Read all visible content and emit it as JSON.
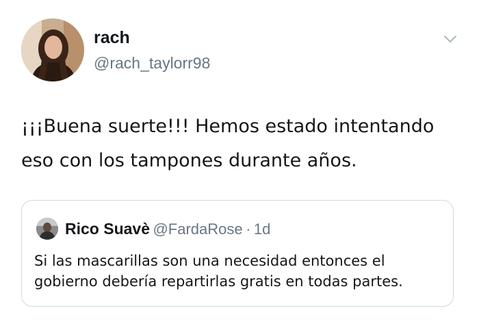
{
  "author": {
    "name": "rach",
    "handle": "@rach_taylorr98"
  },
  "tweet": {
    "text": "¡¡¡Buena suerte!!! Hemos estado intentando\neso con los tampones durante años."
  },
  "quoted": {
    "name": "Rico Suavè",
    "handle": "@FardaRose",
    "separator": "·",
    "time": "1d",
    "text": "Si las mascarillas son una necesidad entonces el\ngobierno debería repartirlas gratis en todas partes."
  },
  "icons": {
    "menu": "chevron-down-icon"
  },
  "colors": {
    "text": "#14171a",
    "secondary": "#657786",
    "border": "#cfd9de"
  }
}
